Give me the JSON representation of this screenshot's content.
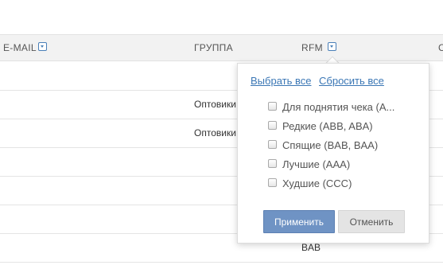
{
  "columns": {
    "email": "E-MAIL",
    "group": "ГРУППА",
    "rfm": "RFM",
    "next_partial": "С"
  },
  "rows": [
    {
      "group": "",
      "rfm": ""
    },
    {
      "group": "Оптовики",
      "rfm": ""
    },
    {
      "group": "Оптовики",
      "rfm": ""
    },
    {
      "group": "",
      "rfm": ""
    },
    {
      "group": "",
      "rfm": ""
    },
    {
      "group": "",
      "rfm": ""
    },
    {
      "group": "",
      "rfm": "BAB"
    }
  ],
  "filter_popup": {
    "select_all": "Выбрать все",
    "reset_all": "Сбросить все",
    "options": [
      {
        "label": "Для поднятия чека (A...",
        "checked": false
      },
      {
        "label": "Редкие (ABB, ABA)",
        "checked": false
      },
      {
        "label": "Спящие (BAB, BAA)",
        "checked": false
      },
      {
        "label": "Лучшие (AAA)",
        "checked": false
      },
      {
        "label": "Худшие (CCC)",
        "checked": false
      }
    ],
    "apply": "Применить",
    "cancel": "Отменить"
  }
}
